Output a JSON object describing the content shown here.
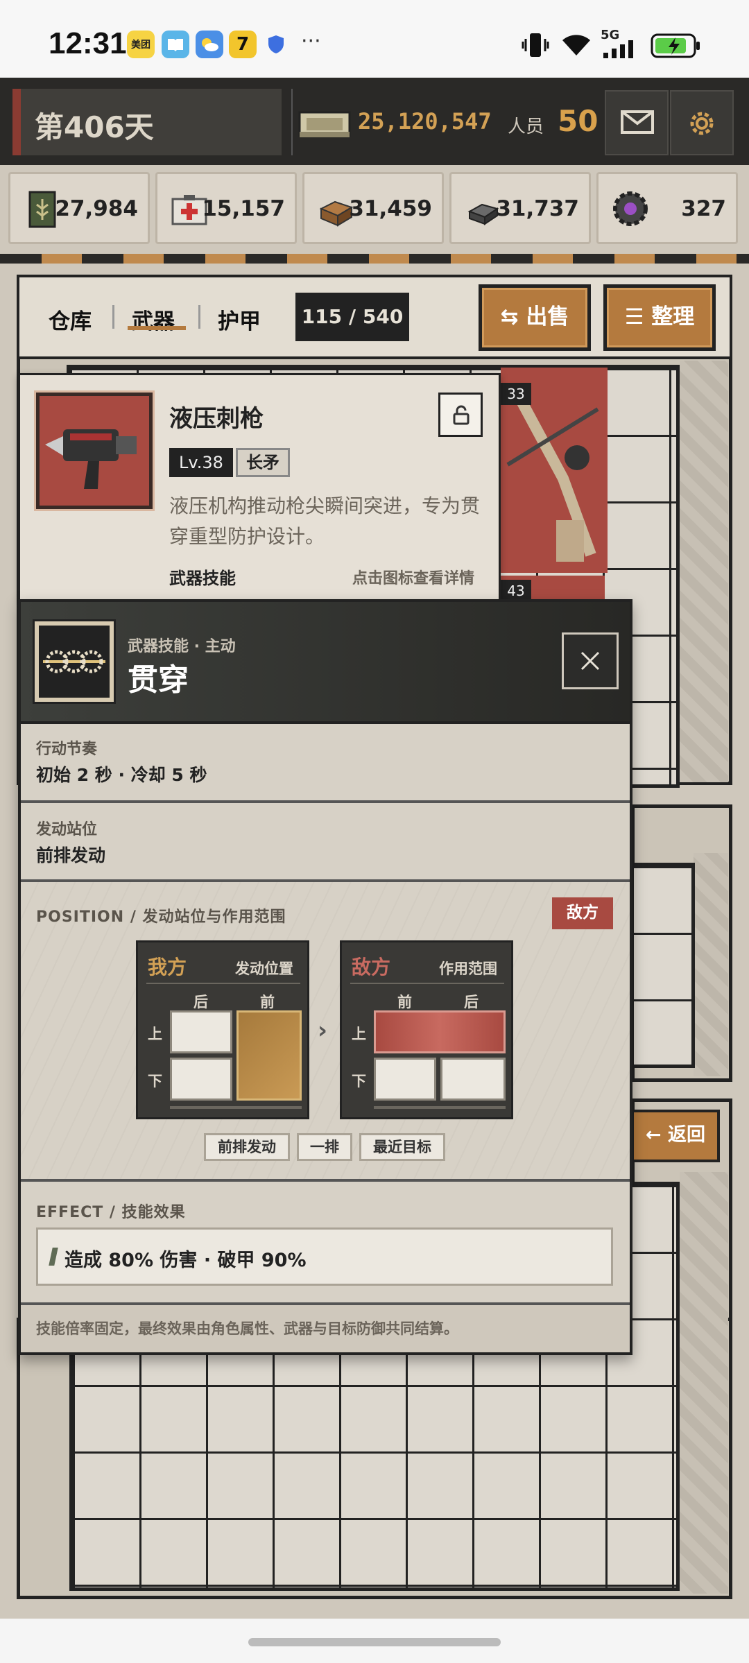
{
  "status_bar": {
    "time": "12:31",
    "apps": [
      "美团"
    ],
    "more": "···",
    "network": "5G"
  },
  "header": {
    "day": "第406天",
    "money": "25,120,547",
    "staff_label": "人员",
    "staff_value": "50"
  },
  "resources": [
    {
      "icon": "grain-sack-icon",
      "value": "27,984"
    },
    {
      "icon": "medkit-icon",
      "value": "15,157"
    },
    {
      "icon": "wood-icon",
      "value": "31,459"
    },
    {
      "icon": "iron-ingot-icon",
      "value": "31,737"
    },
    {
      "icon": "gear-part-icon",
      "value": "327"
    }
  ],
  "inventory": {
    "tabs": [
      "仓库",
      "武器",
      "护甲"
    ],
    "active_tab": "武器",
    "count": "115 / 540",
    "sell_label": "出售",
    "sort_label": "整理",
    "back_label": "返回",
    "badges": [
      "33",
      "43"
    ]
  },
  "item": {
    "name": "液压刺枪",
    "level": "Lv.38",
    "type": "长矛",
    "description": "液压机构推动枪尖瞬间突进，专为贯穿重型防护设计。",
    "skill_label": "武器技能",
    "skill_hint": "点击图标查看详情"
  },
  "skill": {
    "subtitle": "武器技能 · 主动",
    "title": "贯穿",
    "rhythm_label": "行动节奏",
    "rhythm_value": "初始 2 秒 · 冷却 5 秒",
    "stance_label": "发动站位",
    "stance_value": "前排发动",
    "position_header": "POSITION / 发动站位与作用范围",
    "target_badge": "敌方",
    "ally_panel": {
      "title": "我方",
      "subtitle": "发动位置",
      "col_back": "后",
      "col_front": "前",
      "row_top": "上",
      "row_bottom": "下"
    },
    "enemy_panel": {
      "title": "敌方",
      "subtitle": "作用范围",
      "col_front": "前",
      "col_back": "后",
      "row_top": "上",
      "row_bottom": "下"
    },
    "arrow": "›",
    "tags": [
      "前排发动",
      "一排",
      "最近目标"
    ],
    "effect_header": "EFFECT / 技能效果",
    "effect_text": "造成 80% 伤害 · 破甲 90%",
    "footer": "技能倍率固定，最终效果由角色属性、武器与目标防御共同结算。"
  },
  "colors": {
    "accent_brown": "#b47a3e",
    "enemy_red": "#a84a41",
    "dark": "#222222",
    "gold": "#d3a155"
  }
}
